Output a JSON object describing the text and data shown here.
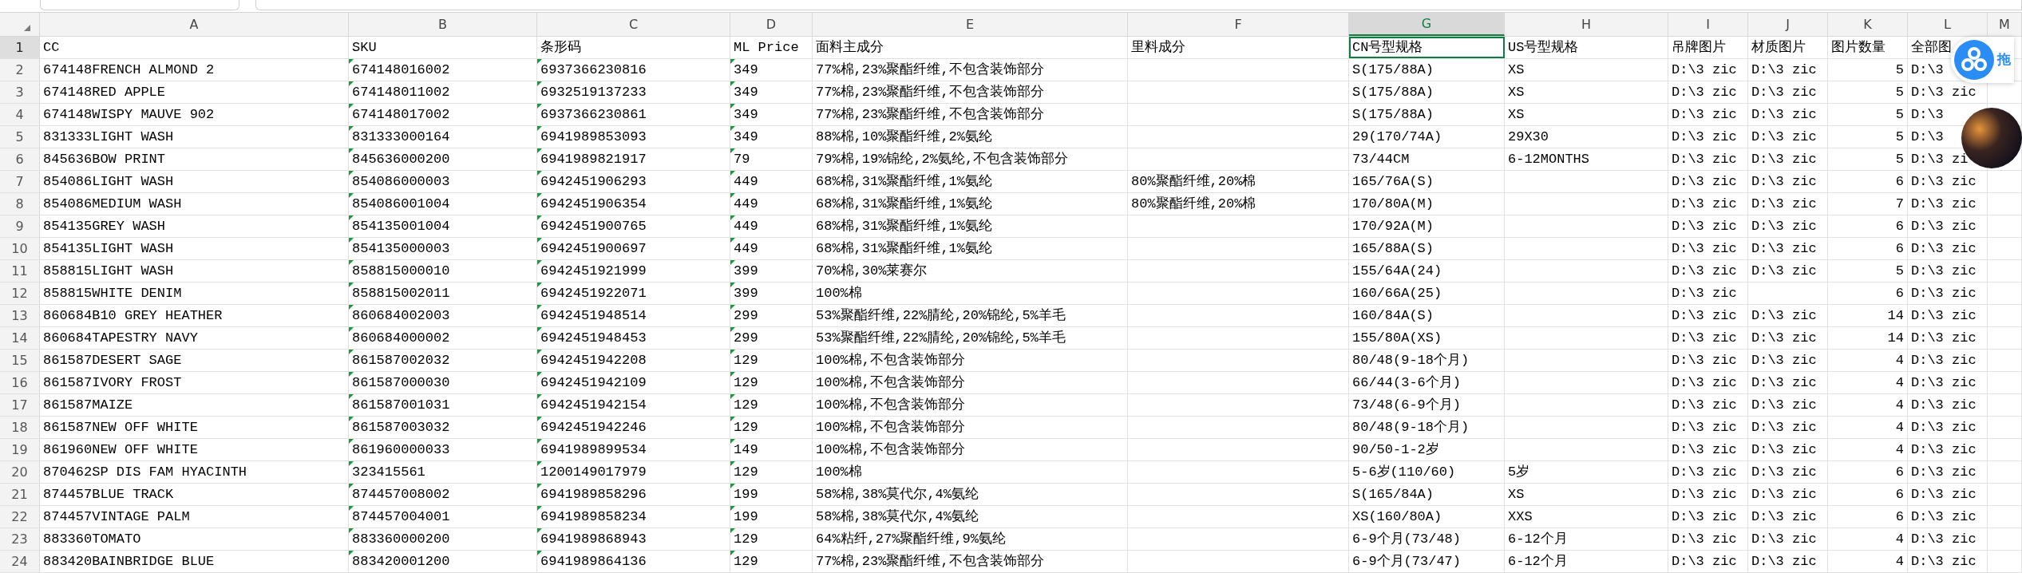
{
  "columns": [
    {
      "letter": "A",
      "selected": false,
      "kind": "text",
      "text_flag": false
    },
    {
      "letter": "B",
      "selected": false,
      "kind": "text",
      "text_flag": true
    },
    {
      "letter": "C",
      "selected": false,
      "kind": "text",
      "text_flag": true
    },
    {
      "letter": "D",
      "selected": false,
      "kind": "text",
      "text_flag": true
    },
    {
      "letter": "E",
      "selected": false,
      "kind": "text",
      "text_flag": false
    },
    {
      "letter": "F",
      "selected": false,
      "kind": "text",
      "text_flag": false
    },
    {
      "letter": "G",
      "selected": true,
      "kind": "text",
      "text_flag": false
    },
    {
      "letter": "H",
      "selected": false,
      "kind": "text",
      "text_flag": false
    },
    {
      "letter": "I",
      "selected": false,
      "kind": "text",
      "text_flag": false
    },
    {
      "letter": "J",
      "selected": false,
      "kind": "text",
      "text_flag": false
    },
    {
      "letter": "K",
      "selected": false,
      "kind": "number",
      "text_flag": false
    },
    {
      "letter": "L",
      "selected": false,
      "kind": "text",
      "text_flag": false
    },
    {
      "letter": "M",
      "selected": false,
      "kind": "text",
      "text_flag": false
    }
  ],
  "rows": [
    {
      "number": "1",
      "kind": "header",
      "selected": true,
      "cells": [
        "CC",
        "SKU",
        "条形码",
        "ML Price",
        "面料主成分",
        "里料成分",
        "CN号型规格",
        "US号型规格",
        "吊牌图片",
        "材质图片",
        "图片数量",
        "全部图",
        null
      ]
    },
    {
      "number": "2",
      "kind": "data",
      "selected": false,
      "cells": [
        "674148FRENCH ALMOND 2",
        "674148016002",
        "6937366230816",
        "349",
        "77%棉,23%聚酯纤维,不包含装饰部分",
        null,
        "S(175/88A)",
        "XS",
        "D:\\3 zic",
        "D:\\3 zic",
        "5",
        "D:\\3",
        null
      ]
    },
    {
      "number": "3",
      "kind": "data",
      "selected": false,
      "cells": [
        "674148RED APPLE",
        "674148011002",
        "6932519137233",
        "349",
        "77%棉,23%聚酯纤维,不包含装饰部分",
        null,
        "S(175/88A)",
        "XS",
        "D:\\3 zic",
        "D:\\3 zic",
        "5",
        "D:\\3 zic",
        null
      ]
    },
    {
      "number": "4",
      "kind": "data",
      "selected": false,
      "cells": [
        "674148WISPY MAUVE 902",
        "674148017002",
        "6937366230861",
        "349",
        "77%棉,23%聚酯纤维,不包含装饰部分",
        null,
        "S(175/88A)",
        "XS",
        "D:\\3 zic",
        "D:\\3 zic",
        "5",
        "D:\\3",
        null
      ]
    },
    {
      "number": "5",
      "kind": "data",
      "selected": false,
      "cells": [
        "831333LIGHT WASH",
        "831333000164",
        "6941989853093",
        "349",
        "88%棉,10%聚酯纤维,2%氨纶",
        null,
        "29(170/74A)",
        "29X30",
        "D:\\3 zic",
        "D:\\3 zic",
        "5",
        "D:\\3",
        null
      ]
    },
    {
      "number": "6",
      "kind": "data",
      "selected": false,
      "cells": [
        "845636BOW PRINT",
        "845636000200",
        "6941989821917",
        "79",
        "79%棉,19%锦纶,2%氨纶,不包含装饰部分",
        null,
        "73/44CM",
        "6-12MONTHS",
        "D:\\3 zic",
        "D:\\3 zic",
        "5",
        "D:\\3 zi",
        null
      ]
    },
    {
      "number": "7",
      "kind": "data",
      "selected": false,
      "cells": [
        "854086LIGHT WASH",
        "854086000003",
        "6942451906293",
        "449",
        "68%棉,31%聚酯纤维,1%氨纶",
        "80%聚酯纤维,20%棉",
        "165/76A(S)",
        null,
        "D:\\3 zic",
        "D:\\3 zic",
        "6",
        "D:\\3 zic",
        null
      ]
    },
    {
      "number": "8",
      "kind": "data",
      "selected": false,
      "cells": [
        "854086MEDIUM WASH",
        "854086001004",
        "6942451906354",
        "449",
        "68%棉,31%聚酯纤维,1%氨纶",
        "80%聚酯纤维,20%棉",
        "170/80A(M)",
        null,
        "D:\\3 zic",
        "D:\\3 zic",
        "7",
        "D:\\3 zic",
        null
      ]
    },
    {
      "number": "9",
      "kind": "data",
      "selected": false,
      "cells": [
        "854135GREY WASH",
        "854135001004",
        "6942451900765",
        "449",
        "68%棉,31%聚酯纤维,1%氨纶",
        null,
        "170/92A(M)",
        null,
        "D:\\3 zic",
        "D:\\3 zic",
        "6",
        "D:\\3 zic",
        null
      ]
    },
    {
      "number": "10",
      "kind": "data",
      "selected": false,
      "cells": [
        "854135LIGHT WASH",
        "854135000003",
        "6942451900697",
        "449",
        "68%棉,31%聚酯纤维,1%氨纶",
        null,
        "165/88A(S)",
        null,
        "D:\\3 zic",
        "D:\\3 zic",
        "6",
        "D:\\3 zic",
        null
      ]
    },
    {
      "number": "11",
      "kind": "data",
      "selected": false,
      "cells": [
        "858815LIGHT WASH",
        "858815000010",
        "6942451921999",
        "399",
        "70%棉,30%莱赛尔",
        null,
        "155/64A(24)",
        null,
        "D:\\3 zic",
        "D:\\3 zic",
        "5",
        "D:\\3 zic",
        null
      ]
    },
    {
      "number": "12",
      "kind": "data",
      "selected": false,
      "cells": [
        "858815WHITE DENIM",
        "858815002011",
        "6942451922071",
        "399",
        "100%棉",
        null,
        "160/66A(25)",
        null,
        "D:\\3 zic",
        null,
        "6",
        "D:\\3 zic",
        null
      ]
    },
    {
      "number": "13",
      "kind": "data",
      "selected": false,
      "cells": [
        "860684B10 GREY HEATHER",
        "860684002003",
        "6942451948514",
        "299",
        "53%聚酯纤维,22%腈纶,20%锦纶,5%羊毛",
        null,
        "160/84A(S)",
        null,
        "D:\\3 zic",
        "D:\\3 zic",
        "14",
        "D:\\3 zic",
        null
      ]
    },
    {
      "number": "14",
      "kind": "data",
      "selected": false,
      "cells": [
        "860684TAPESTRY NAVY",
        "860684000002",
        "6942451948453",
        "299",
        "53%聚酯纤维,22%腈纶,20%锦纶,5%羊毛",
        null,
        "155/80A(XS)",
        null,
        "D:\\3 zic",
        "D:\\3 zic",
        "14",
        "D:\\3 zic",
        null
      ]
    },
    {
      "number": "15",
      "kind": "data",
      "selected": false,
      "cells": [
        "861587DESERT SAGE",
        "861587002032",
        "6942451942208",
        "129",
        "100%棉,不包含装饰部分",
        null,
        "80/48(9-18个月)",
        null,
        "D:\\3 zic",
        "D:\\3 zic",
        "4",
        "D:\\3 zic",
        null
      ]
    },
    {
      "number": "16",
      "kind": "data",
      "selected": false,
      "cells": [
        "861587IVORY FROST",
        "861587000030",
        "6942451942109",
        "129",
        "100%棉,不包含装饰部分",
        null,
        "66/44(3-6个月)",
        null,
        "D:\\3 zic",
        "D:\\3 zic",
        "4",
        "D:\\3 zic",
        null
      ]
    },
    {
      "number": "17",
      "kind": "data",
      "selected": false,
      "cells": [
        "861587MAIZE",
        "861587001031",
        "6942451942154",
        "129",
        "100%棉,不包含装饰部分",
        null,
        "73/48(6-9个月)",
        null,
        "D:\\3 zic",
        "D:\\3 zic",
        "4",
        "D:\\3 zic",
        null
      ]
    },
    {
      "number": "18",
      "kind": "data",
      "selected": false,
      "cells": [
        "861587NEW OFF WHITE",
        "861587003032",
        "6942451942246",
        "129",
        "100%棉,不包含装饰部分",
        null,
        "80/48(9-18个月)",
        null,
        "D:\\3 zic",
        "D:\\3 zic",
        "4",
        "D:\\3 zic",
        null
      ]
    },
    {
      "number": "19",
      "kind": "data",
      "selected": false,
      "cells": [
        "861960NEW OFF WHITE",
        "861960000033",
        "6941989899534",
        "149",
        "100%棉,不包含装饰部分",
        null,
        "90/50-1-2岁",
        null,
        "D:\\3 zic",
        "D:\\3 zic",
        "4",
        "D:\\3 zic",
        null
      ]
    },
    {
      "number": "20",
      "kind": "data",
      "selected": false,
      "cells": [
        "870462SP DIS FAM HYACINTH",
        "323415561",
        "1200149017979",
        "129",
        "100%棉",
        null,
        "5-6岁(110/60)",
        "5岁",
        "D:\\3 zic",
        "D:\\3 zic",
        "6",
        "D:\\3 zic",
        null
      ]
    },
    {
      "number": "21",
      "kind": "data",
      "selected": false,
      "cells": [
        "874457BLUE TRACK",
        "874457008002",
        "6941989858296",
        "199",
        "58%棉,38%莫代尔,4%氨纶",
        null,
        "S(165/84A)",
        "XS",
        "D:\\3 zic",
        "D:\\3 zic",
        "6",
        "D:\\3 zic",
        null
      ]
    },
    {
      "number": "22",
      "kind": "data",
      "selected": false,
      "cells": [
        "874457VINTAGE PALM",
        "874457004001",
        "6941989858234",
        "199",
        "58%棉,38%莫代尔,4%氨纶",
        null,
        "XS(160/80A)",
        "XXS",
        "D:\\3 zic",
        "D:\\3 zic",
        "6",
        "D:\\3 zic",
        null
      ]
    },
    {
      "number": "23",
      "kind": "data",
      "selected": false,
      "cells": [
        "883360TOMATO",
        "883360000200",
        "6941989868943",
        "129",
        "64%粘纤,27%聚酯纤维,9%氨纶",
        null,
        "6-9个月(73/48)",
        "6-12个月",
        "D:\\3 zic",
        "D:\\3 zic",
        "4",
        "D:\\3 zic",
        null
      ]
    },
    {
      "number": "24",
      "kind": "data",
      "selected": false,
      "cells": [
        "883420BAINBRIDGE BLUE",
        "883420001200",
        "6941989864136",
        "129",
        "77%棉,23%聚酯纤维,不包含装饰部分",
        null,
        "6-9个月(73/47)",
        "6-12个月",
        "D:\\3 zic",
        "D:\\3 zic",
        "4",
        "D:\\3 zic",
        null
      ]
    }
  ],
  "float_widget": {
    "label": "拖"
  }
}
